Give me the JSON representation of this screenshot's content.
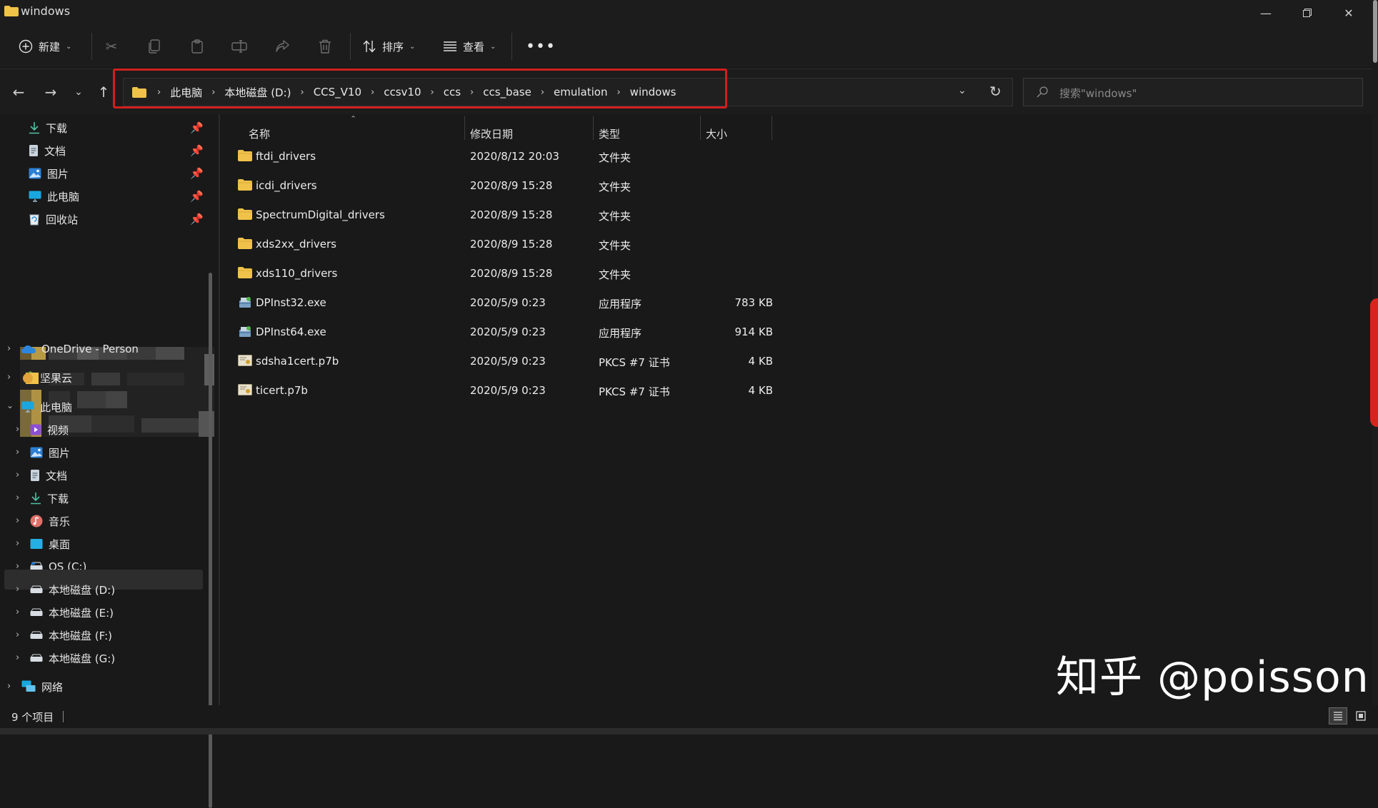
{
  "window": {
    "title": "windows",
    "minimize_icon": "minimize-icon",
    "maximize_icon": "restore-icon",
    "close_icon": "close-icon"
  },
  "toolbar": {
    "new_label": "新建",
    "sort_label": "排序",
    "view_label": "查看",
    "more_icon": "more-icon"
  },
  "address": {
    "crumbs": [
      "此电脑",
      "本地磁盘 (D:)",
      "CCS_V10",
      "ccsv10",
      "ccs",
      "ccs_base",
      "emulation",
      "windows"
    ],
    "search_placeholder": "搜索\"windows\""
  },
  "sidebar": {
    "quick": [
      {
        "label": "下载",
        "icon": "download-icon"
      },
      {
        "label": "文档",
        "icon": "document-icon"
      },
      {
        "label": "图片",
        "icon": "pictures-icon"
      },
      {
        "label": "此电脑",
        "icon": "this-pc-icon"
      },
      {
        "label": "回收站",
        "icon": "recycle-bin-icon"
      }
    ],
    "onedrive": "OneDrive - Person",
    "jianguoyun": "坚果云",
    "this_pc": "此电脑",
    "pc_items": [
      {
        "label": "视频",
        "icon": "videos-icon"
      },
      {
        "label": "图片",
        "icon": "pictures-icon"
      },
      {
        "label": "文档",
        "icon": "document-icon"
      },
      {
        "label": "下载",
        "icon": "download-icon"
      },
      {
        "label": "音乐",
        "icon": "music-icon"
      },
      {
        "label": "桌面",
        "icon": "desktop-icon"
      },
      {
        "label": "OS (C:)",
        "icon": "drive-icon"
      },
      {
        "label": "本地磁盘 (D:)",
        "icon": "drive-icon"
      },
      {
        "label": "本地磁盘 (E:)",
        "icon": "drive-icon"
      },
      {
        "label": "本地磁盘 (F:)",
        "icon": "drive-icon"
      },
      {
        "label": "本地磁盘 (G:)",
        "icon": "drive-icon"
      }
    ],
    "network": "网络"
  },
  "columns": {
    "name": "名称",
    "modified": "修改日期",
    "type": "类型",
    "size": "大小"
  },
  "files": [
    {
      "name": "ftdi_drivers",
      "date": "2020/8/12 20:03",
      "type": "文件夹",
      "size": "",
      "icon": "folder-icon"
    },
    {
      "name": "icdi_drivers",
      "date": "2020/8/9 15:28",
      "type": "文件夹",
      "size": "",
      "icon": "folder-icon"
    },
    {
      "name": "SpectrumDigital_drivers",
      "date": "2020/8/9 15:28",
      "type": "文件夹",
      "size": "",
      "icon": "folder-icon"
    },
    {
      "name": "xds2xx_drivers",
      "date": "2020/8/9 15:28",
      "type": "文件夹",
      "size": "",
      "icon": "folder-icon"
    },
    {
      "name": "xds110_drivers",
      "date": "2020/8/9 15:28",
      "type": "文件夹",
      "size": "",
      "icon": "folder-icon"
    },
    {
      "name": "DPInst32.exe",
      "date": "2020/5/9 0:23",
      "type": "应用程序",
      "size": "783 KB",
      "icon": "installer-icon"
    },
    {
      "name": "DPInst64.exe",
      "date": "2020/5/9 0:23",
      "type": "应用程序",
      "size": "914 KB",
      "icon": "installer-icon"
    },
    {
      "name": "sdsha1cert.p7b",
      "date": "2020/5/9 0:23",
      "type": "PKCS #7 证书",
      "size": "4 KB",
      "icon": "certificate-icon"
    },
    {
      "name": "ticert.p7b",
      "date": "2020/5/9 0:23",
      "type": "PKCS #7 证书",
      "size": "4 KB",
      "icon": "certificate-icon"
    }
  ],
  "status": {
    "item_count": "9 个项目"
  },
  "watermark": "知乎 @poisson",
  "colors": {
    "background": "#191919",
    "highlight_border": "#d11f1f",
    "folder": "#f0c24a"
  }
}
